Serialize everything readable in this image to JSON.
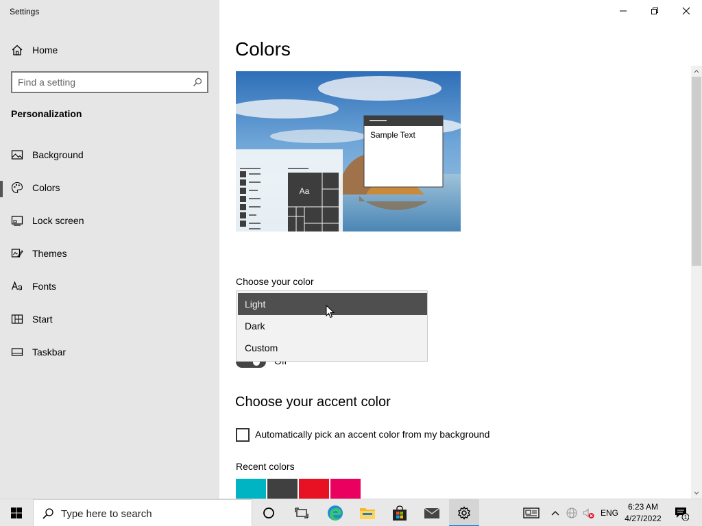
{
  "window": {
    "title": "Settings"
  },
  "sidebar": {
    "home_label": "Home",
    "search_placeholder": "Find a setting",
    "section_title": "Personalization",
    "items": [
      {
        "label": "Background",
        "icon": "picture-icon",
        "selected": false
      },
      {
        "label": "Colors",
        "icon": "palette-icon",
        "selected": true
      },
      {
        "label": "Lock screen",
        "icon": "lock-screen-icon",
        "selected": false
      },
      {
        "label": "Themes",
        "icon": "themes-icon",
        "selected": false
      },
      {
        "label": "Fonts",
        "icon": "fonts-icon",
        "selected": false
      },
      {
        "label": "Start",
        "icon": "start-icon",
        "selected": false
      },
      {
        "label": "Taskbar",
        "icon": "taskbar-icon",
        "selected": false
      }
    ]
  },
  "main": {
    "title": "Colors",
    "preview": {
      "sample_text": "Sample Text",
      "tile_label": "Aa"
    },
    "choose_color": {
      "label": "Choose your color",
      "options": [
        "Light",
        "Dark",
        "Custom"
      ],
      "selected": "Light"
    },
    "toggle_partial_text": "Off",
    "accent": {
      "title": "Choose your accent color",
      "auto_pick_label": "Automatically pick an accent color from my background",
      "auto_pick_checked": false,
      "recent_label": "Recent colors",
      "recent_colors": [
        "#00b4c4",
        "#404040",
        "#e81123",
        "#ea005e"
      ]
    }
  },
  "taskbar": {
    "search_placeholder": "Type here to search",
    "language": "ENG",
    "time": "6:23 AM",
    "date": "4/27/2022",
    "notification_count": "1"
  }
}
